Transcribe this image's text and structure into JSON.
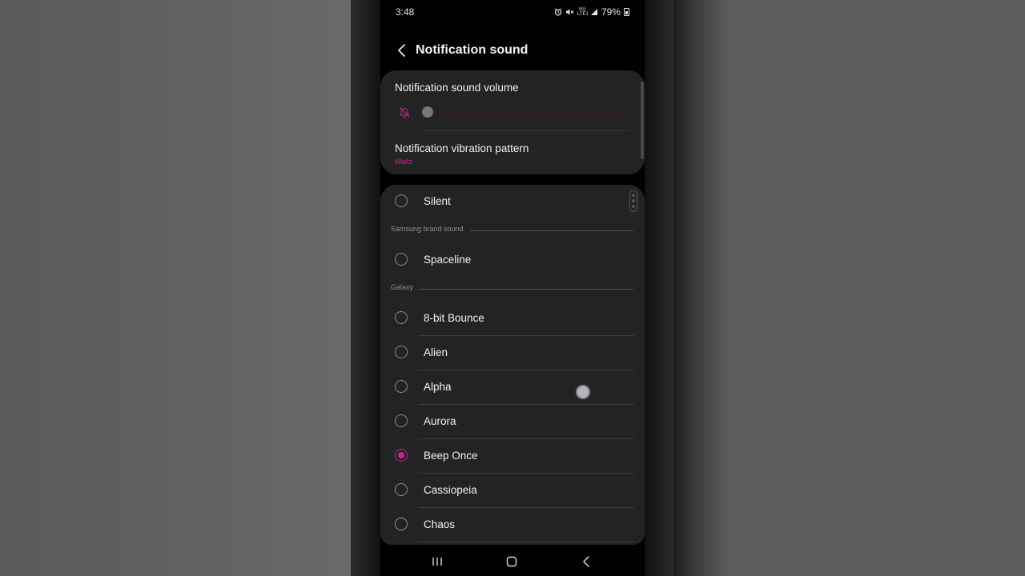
{
  "status_bar": {
    "time": "3:48",
    "battery": "79%",
    "network_label": "Vo) LTE1",
    "icons": [
      "alarm-icon",
      "mute-icon",
      "volte-icon",
      "battery-icon"
    ]
  },
  "header": {
    "title": "Notification sound",
    "back_icon": "back-arrow-icon"
  },
  "settings_card": {
    "volume_label": "Notification sound volume",
    "volume_level": 0,
    "volume_icon": "notifications-off-icon",
    "vibration_label": "Notification vibration pattern",
    "vibration_value": "Waltz"
  },
  "sound_list": {
    "silent": {
      "label": "Silent",
      "selected": false
    },
    "sections": [
      {
        "title": "Samsung brand sound",
        "items": [
          {
            "label": "Spaceline",
            "selected": false
          }
        ]
      },
      {
        "title": "Galaxy",
        "items": [
          {
            "label": "8-bit Bounce",
            "selected": false
          },
          {
            "label": "Alien",
            "selected": false
          },
          {
            "label": "Alpha",
            "selected": false
          },
          {
            "label": "Aurora",
            "selected": false
          },
          {
            "label": "Beep Once",
            "selected": true
          },
          {
            "label": "Cassiopeia",
            "selected": false
          },
          {
            "label": "Chaos",
            "selected": false
          }
        ]
      }
    ]
  },
  "nav_bar": {
    "recents_icon": "recents-icon",
    "home_icon": "home-icon",
    "back_icon": "nav-back-icon"
  },
  "colors": {
    "accent": "#c0288f",
    "card_background": "#232323",
    "background": "#000000"
  }
}
